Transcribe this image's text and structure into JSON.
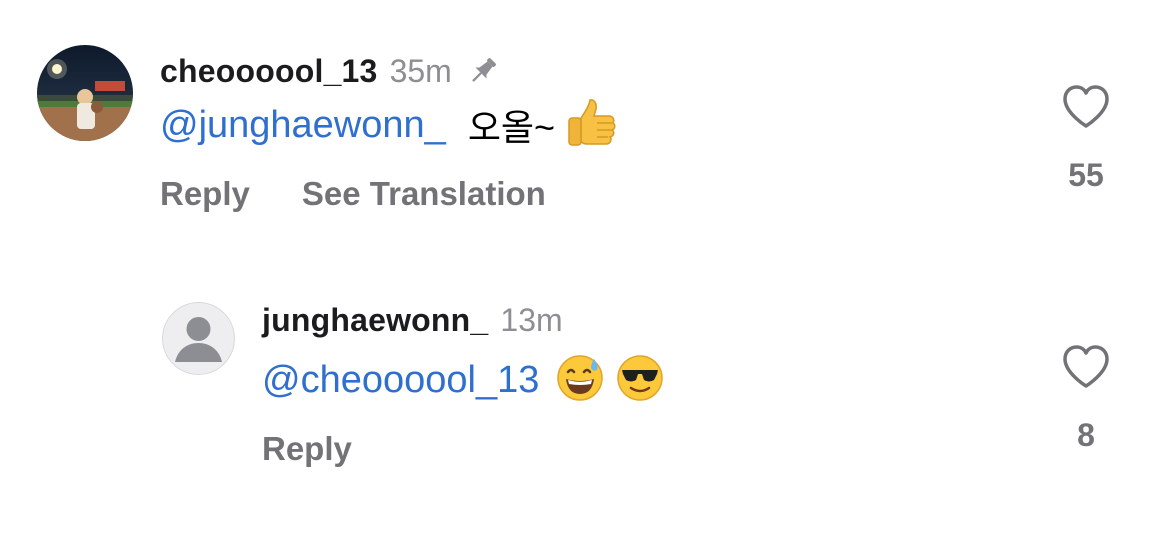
{
  "comments": [
    {
      "username": "cheoooool_13",
      "time": "35m",
      "pinned": true,
      "mention": "@junghaewonn_",
      "text": "오올~",
      "emojis": [
        "thumbs-up-emoji"
      ],
      "actions": {
        "reply": "Reply",
        "translate": "See Translation"
      },
      "likes": "55",
      "avatar": "baseball-stadium-photo"
    },
    {
      "username": "junghaewonn_",
      "time": "13m",
      "pinned": false,
      "mention": "@cheoooool_13",
      "text": "",
      "emojis": [
        "grinning-sweat-emoji",
        "sunglasses-emoji"
      ],
      "actions": {
        "reply": "Reply"
      },
      "likes": "8",
      "avatar": "default-avatar"
    }
  ],
  "colors": {
    "mention": "#2f6fd0",
    "muted": "#737377",
    "timestamp": "#8e8e93",
    "username": "#1c1c1e"
  }
}
